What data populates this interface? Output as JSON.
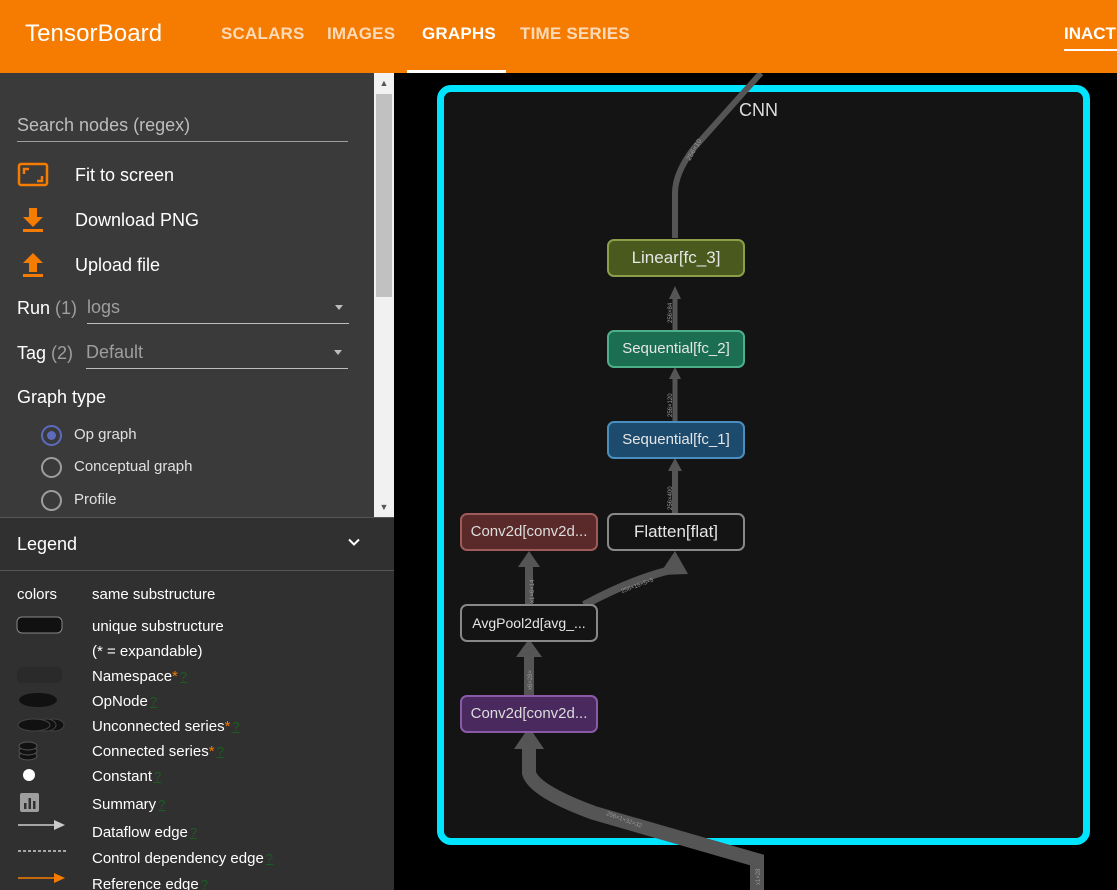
{
  "header": {
    "brand": "TensorBoard",
    "tabs": [
      {
        "label": "SCALARS"
      },
      {
        "label": "IMAGES"
      },
      {
        "label": "GRAPHS"
      },
      {
        "label": "TIME SERIES"
      }
    ],
    "inactive_label": "INACTI"
  },
  "sidebar": {
    "search_placeholder": "Search nodes (regex)",
    "actions": {
      "fit": "Fit to screen",
      "download": "Download PNG",
      "upload": "Upload file"
    },
    "run": {
      "label": "Run",
      "count": "(1)",
      "value": "logs"
    },
    "tag": {
      "label": "Tag",
      "count": "(2)",
      "value": "Default"
    },
    "graph_type": {
      "title": "Graph type",
      "options": [
        "Op graph",
        "Conceptual graph",
        "Profile"
      ],
      "selected": "Op graph"
    }
  },
  "legend": {
    "title": "Legend",
    "colors_label": "colors",
    "same_label": "same substructure",
    "unique_label": "unique substructure",
    "expandable_note": "(* = expandable)",
    "items": {
      "namespace": "Namespace",
      "opnode": "OpNode",
      "unconnected": "Unconnected series",
      "connected": "Connected series",
      "constant": "Constant",
      "summary": "Summary",
      "dataflow": "Dataflow edge",
      "control": "Control dependency edge",
      "reference": "Reference edge"
    },
    "help": "?",
    "star": "*"
  },
  "graph": {
    "scope_label": "CNN",
    "nodes": {
      "linear": "Linear[fc_3]",
      "seq2": "Sequential[fc_2]",
      "seq1": "Sequential[fc_1]",
      "flatten": "Flatten[flat]",
      "conv2": "Conv2d[conv2d...",
      "avgpool": "AvgPool2d[avg_...",
      "conv1": "Conv2d[conv2d..."
    },
    "edge_labels": {
      "top": "256×10",
      "linear_in": "256×84",
      "seq2_in": "256×120",
      "seq1_in": "256×400",
      "flat_in": "256×16×5×5",
      "conv2_in": "x1×6×14",
      "conv1_out": "x6×28×",
      "input": "256×1×32×32",
      "bottom": "x1×28"
    },
    "colors": {
      "linear": "#4a5a1e",
      "seq2": "#1b6e52",
      "seq1": "#1d4b6e",
      "conv2": "#5a2a2a",
      "conv1": "#4a2a5e",
      "frame": "#00e5ff"
    }
  }
}
